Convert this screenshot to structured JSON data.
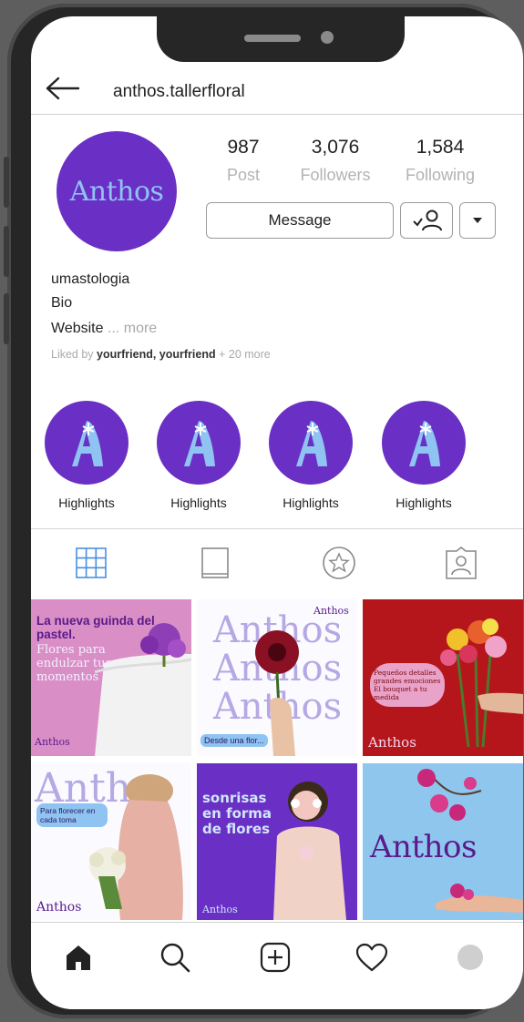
{
  "profile": {
    "handle": "anthos.tallerfloral",
    "avatar_brand": "Anthos",
    "stats": [
      {
        "value": "987",
        "label": "Post"
      },
      {
        "value": "3,076",
        "label": "Followers"
      },
      {
        "value": "1,584",
        "label": "Following"
      }
    ],
    "message_label": "Message",
    "username": "umastologia",
    "bio": "Bio",
    "website": "Website",
    "more": "... more",
    "liked_prefix": "Liked by",
    "liked_users": "yourfriend, yourfriend",
    "liked_suffix": "+ 20 more"
  },
  "highlights": [
    {
      "label": "Highlights"
    },
    {
      "label": "Highlights"
    },
    {
      "label": "Highlights"
    },
    {
      "label": "Highlights"
    }
  ],
  "tabs": [
    "grid-icon",
    "reels-icon",
    "star-icon",
    "tagged-icon"
  ],
  "posts": [
    {
      "headline": "La nueva guinda del pastel.",
      "sub": "Flores para endulzar tus momentos",
      "brand": "Anthos"
    },
    {
      "brand": "Anthos",
      "big": "Anthos",
      "caption": "Desde una flor..."
    },
    {
      "caption": "Pequeños detalles grandes emociones El bouquet a tu medida",
      "brand": "Anthos"
    },
    {
      "brand": "Anthos",
      "big": "Anth",
      "caption": "Para florecer en cada toma"
    },
    {
      "caption": "sonrisas en forma de flores",
      "brand": "Anthos"
    },
    {
      "brand": "Anthos"
    }
  ],
  "colors": {
    "brand_purple": "#6a2fc4",
    "brand_blue": "#8fc3f2",
    "red": "#b5161c",
    "pink": "#d88cc8",
    "sky": "#8ec6ee"
  },
  "nav": [
    "home-icon",
    "search-icon",
    "add-icon",
    "heart-icon",
    "profile-icon"
  ]
}
